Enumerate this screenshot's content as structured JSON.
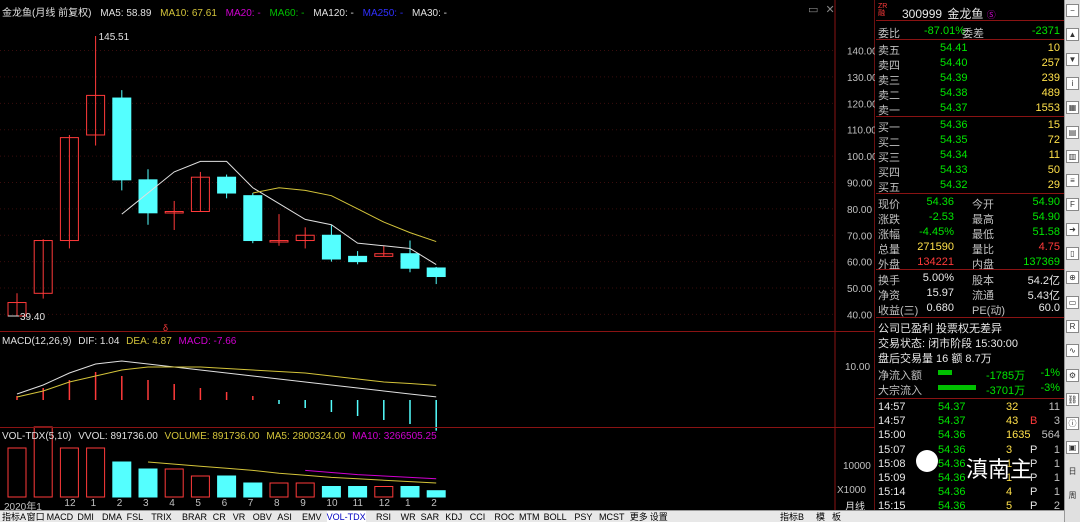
{
  "header": {
    "title": "金龙鱼(月线 前复权)",
    "ma5": "MA5: 58.89",
    "ma10": "MA10: 67.61",
    "ma20": "MA20: -",
    "ma60": "MA60: -",
    "ma120": "MA120: -",
    "ma250": "MA250: -",
    "ma30": "MA30: -"
  },
  "price_axis": [
    "140.00",
    "130.00",
    "120.00",
    "110.00",
    "100.00",
    "90.00",
    "80.00",
    "70.00",
    "60.00",
    "50.00",
    "40.00"
  ],
  "high_label": "145.51",
  "low_label": "39.40",
  "macd": {
    "title": "MACD(12,26,9)",
    "dif": "DIF: 1.04",
    "dea": "DEA: 4.87",
    "macd": "MACD: -7.66",
    "axis": "10.00"
  },
  "vol": {
    "title": "VOL-TDX(5,10)",
    "vvol": "VVOL: 891736.00",
    "volume": "VOLUME: 891736.00",
    "ma5": "MA5: 2800324.00",
    "ma10": "MA10: 3266505.25",
    "axis1": "10000",
    "axis2": "X1000"
  },
  "x_axis": {
    "year": "2020年1",
    "labels": [
      "12",
      "1",
      "2",
      "3",
      "4",
      "5",
      "6",
      "7",
      "8",
      "9",
      "10",
      "11",
      "12",
      "1",
      "2"
    ],
    "right": "月线"
  },
  "colors": {
    "up": "#ff3a3a",
    "down": "#54ffff",
    "ma5": "#e0e0e0",
    "ma10": "#d4c43a",
    "purple": "#d000d0",
    "accent": "#8a1313"
  },
  "chart_data": {
    "type": "candlestick",
    "title": "金龙鱼(月线 前复权)",
    "categories": [
      "2020-10",
      "2020-11",
      "2020-12",
      "2021-01",
      "2021-02",
      "2021-03",
      "2021-04",
      "2021-05",
      "2021-06",
      "2021-07",
      "2021-08",
      "2021-09",
      "2021-10",
      "2021-11",
      "2021-12",
      "2022-01",
      "2022-02"
    ],
    "ohlc": [
      [
        39.4,
        48,
        39.4,
        44.5
      ],
      [
        48,
        68.5,
        46,
        68
      ],
      [
        68,
        108,
        65,
        107
      ],
      [
        108,
        145.51,
        104,
        123
      ],
      [
        122,
        125,
        87,
        91
      ],
      [
        91,
        95,
        74,
        78.5
      ],
      [
        78.5,
        83,
        72,
        79
      ],
      [
        79,
        94,
        79,
        92
      ],
      [
        92,
        93,
        84,
        86
      ],
      [
        85,
        86,
        67,
        68
      ],
      [
        68,
        78,
        66,
        68
      ],
      [
        68,
        73,
        65,
        70
      ],
      [
        70,
        74,
        60,
        61
      ],
      [
        62,
        64,
        59,
        60
      ],
      [
        62,
        66,
        62,
        63
      ],
      [
        63,
        68,
        56,
        57.5
      ],
      [
        57.6,
        58,
        51.5,
        54.36
      ]
    ],
    "ma5": [
      null,
      null,
      null,
      null,
      78,
      86,
      94,
      98,
      98,
      88,
      82,
      76,
      74,
      67,
      66,
      65,
      58.89
    ],
    "ma10": [
      null,
      null,
      null,
      null,
      null,
      null,
      null,
      null,
      null,
      86,
      88,
      87,
      85,
      80,
      75,
      71,
      67.61
    ],
    "ylim": [
      40,
      145
    ]
  },
  "macd_hist": [
    1,
    3,
    5,
    7,
    6,
    5,
    4,
    3,
    2,
    1,
    -1,
    -2,
    -3,
    -4,
    -5,
    -6,
    -7.66
  ],
  "vol_bars": [
    7,
    10,
    7,
    7,
    5,
    4,
    4,
    3,
    3,
    2,
    2,
    2,
    1.5,
    1.5,
    1.5,
    1.5,
    0.9
  ],
  "quote": {
    "code": "300999",
    "name": "金龙鱼",
    "wei_bi_label": "委比",
    "wei_bi": "-87.01%",
    "wei_cha_label": "委差",
    "wei_cha": "-2371",
    "sells": [
      {
        "label": "卖五",
        "price": "54.41",
        "vol": "10"
      },
      {
        "label": "卖四",
        "price": "54.40",
        "vol": "257"
      },
      {
        "label": "卖三",
        "price": "54.39",
        "vol": "239"
      },
      {
        "label": "卖二",
        "price": "54.38",
        "vol": "489"
      },
      {
        "label": "卖一",
        "price": "54.37",
        "vol": "1553"
      }
    ],
    "buys": [
      {
        "label": "买一",
        "price": "54.36",
        "vol": "15"
      },
      {
        "label": "买二",
        "price": "54.35",
        "vol": "72"
      },
      {
        "label": "买三",
        "price": "54.34",
        "vol": "11"
      },
      {
        "label": "买四",
        "price": "54.33",
        "vol": "50"
      },
      {
        "label": "买五",
        "price": "54.32",
        "vol": "29"
      }
    ],
    "stats": [
      {
        "l1": "现价",
        "v1": "54.36",
        "l2": "今开",
        "v2": "54.90"
      },
      {
        "l1": "涨跌",
        "v1": "-2.53",
        "l2": "最高",
        "v2": "54.90"
      },
      {
        "l1": "涨幅",
        "v1": "-4.45%",
        "l2": "最低",
        "v2": "51.58"
      },
      {
        "l1": "总量",
        "v1": "271590",
        "l2": "量比",
        "v2": "4.75"
      },
      {
        "l1": "外盘",
        "v1": "134221",
        "l2": "内盘",
        "v2": "137369"
      }
    ],
    "stats2": [
      {
        "l1": "换手",
        "v1": "5.00%",
        "l2": "股本",
        "v2": "54.2亿"
      },
      {
        "l1": "净资",
        "v1": "15.97",
        "l2": "流通",
        "v2": "5.43亿"
      },
      {
        "l1": "收益(三)",
        "v1": "0.680",
        "l2": "PE(动)",
        "v2": "60.0"
      }
    ],
    "notice": "公司已盈利 投票权无差异",
    "trade_state": "交易状态: 闭市阶段 15:30:00",
    "after_hours": "盘后交易量 16 额 8.7万",
    "net_inflow_label": "净流入额",
    "net_inflow": "-1785万",
    "net_inflow_pct": "-1%",
    "block_label": "大宗流入",
    "block": "-3701万",
    "block_pct": "-3%",
    "ticks": [
      {
        "t": "14:57",
        "p": "54.37",
        "v": "32",
        "n": "11"
      },
      {
        "t": "14:57",
        "p": "54.37",
        "v": "43",
        "f": "B",
        "n": "3"
      },
      {
        "t": "15:00",
        "p": "54.36",
        "v": "1635",
        "n": "564"
      },
      {
        "t": "15:07",
        "p": "54.36",
        "v": "3",
        "f": "P",
        "n": "1"
      },
      {
        "t": "15:08",
        "p": "54.36",
        "v": "1",
        "f": "P",
        "n": "1"
      },
      {
        "t": "15:09",
        "p": "54.36",
        "v": "1",
        "f": "P",
        "n": "1"
      },
      {
        "t": "15:14",
        "p": "54.36",
        "v": "4",
        "f": "P",
        "n": "1"
      },
      {
        "t": "15:15",
        "p": "54.36",
        "v": "5",
        "f": "P",
        "n": "2"
      }
    ]
  },
  "watermark": "滇南主",
  "tabs": [
    "指标A",
    "窗口",
    "MACD",
    "DMI",
    "DMA",
    "FSL",
    "TRIX",
    "BRAR",
    "CR",
    "VR",
    "OBV",
    "ASI",
    "EMV",
    "VOL-TDX",
    "RSI",
    "WR",
    "SAR",
    "KDJ",
    "CCI",
    "ROC",
    "MTM",
    "BOLL",
    "PSY",
    "MCST",
    "更多",
    "设置"
  ],
  "right_tabs": [
    "指标B",
    "模",
    "板"
  ],
  "sidebar_icons": [
    "minus-icon",
    "up-arrow-icon",
    "down-arrow-icon",
    "info-icon",
    "chart-icon",
    "grid-icon",
    "bar-chart-icon",
    "list-icon",
    "f10-icon",
    "arrow-icon",
    "book-icon",
    "zoom-icon",
    "news-icon",
    "rsi-icon",
    "chart-line-icon",
    "settings-icon",
    "link-icon",
    "info2-icon",
    "box-icon",
    "day-label",
    "week-label"
  ],
  "sidebar_labels": {
    "day": "日",
    "week": "周"
  }
}
